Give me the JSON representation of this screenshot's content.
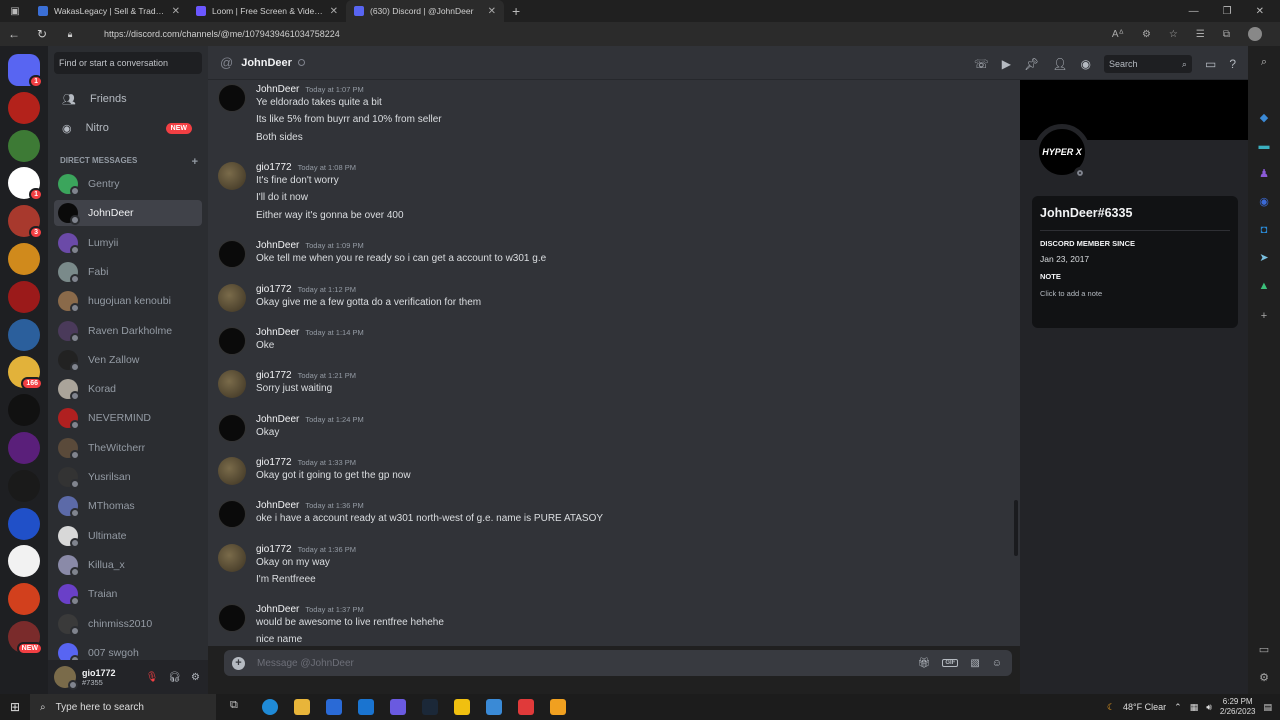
{
  "browser": {
    "tabs": [
      {
        "title": "WakasLegacy | Sell & Trade Gam",
        "color": "#3b6fd6"
      },
      {
        "title": "Loom | Free Screen & Video Rec",
        "color": "#6b57ff"
      },
      {
        "title": "(630) Discord | @JohnDeer",
        "color": "#5865f2"
      }
    ],
    "url": "https://discord.com/channels/@me/1079439461034758224"
  },
  "guilds": [
    {
      "color": "#5865f2",
      "badge": "1"
    },
    {
      "color": "#b3221b",
      "badge": ""
    },
    {
      "color": "#3d7a35",
      "badge": ""
    },
    {
      "color": "#ffffff",
      "badge": "1"
    },
    {
      "color": "#a8392d",
      "badge": "3"
    },
    {
      "color": "#d08a1c",
      "badge": ""
    },
    {
      "color": "#9b1a1a",
      "badge": ""
    },
    {
      "color": "#2b5f9c",
      "badge": ""
    },
    {
      "color": "#e2b23a",
      "badge": "166"
    },
    {
      "color": "#111111",
      "badge": ""
    },
    {
      "color": "#5a1f7a",
      "badge": ""
    },
    {
      "color": "#1a1a1a",
      "badge": ""
    },
    {
      "color": "#2050c8",
      "badge": ""
    },
    {
      "color": "#f2f2f2",
      "badge": ""
    },
    {
      "color": "#d2401d",
      "badge": ""
    },
    {
      "color": "#7a2b2b",
      "badge": "NEW"
    }
  ],
  "sidebar": {
    "search_placeholder": "Find or start a conversation",
    "friends": "Friends",
    "nitro": "Nitro",
    "nitro_badge": "NEW",
    "dm_header": "DIRECT MESSAGES",
    "dms": [
      {
        "name": "Gentry",
        "color": "#3ba55c"
      },
      {
        "name": "JohnDeer",
        "color": "#0a0a0a"
      },
      {
        "name": "Lumyii",
        "color": "#6b4aa8"
      },
      {
        "name": "Fabi",
        "color": "#7a8a8a"
      },
      {
        "name": "hugojuan kenoubi",
        "color": "#8a6a4a"
      },
      {
        "name": "Raven Darkholme",
        "color": "#4a3a5a"
      },
      {
        "name": "Ven Zallow",
        "color": "#222222"
      },
      {
        "name": "Korad",
        "color": "#aaa49a"
      },
      {
        "name": "NEVERMIND",
        "color": "#b02020"
      },
      {
        "name": "TheWitcherr",
        "color": "#5a4a3a"
      },
      {
        "name": "Yusrilsan",
        "color": "#333333"
      },
      {
        "name": "MThomas",
        "color": "#5c6aa8"
      },
      {
        "name": "Ultimate",
        "color": "#d8d8d8"
      },
      {
        "name": "Killua_x",
        "color": "#8a8aa8"
      },
      {
        "name": "Traian",
        "color": "#6a40c8"
      },
      {
        "name": "chinmiss2010",
        "color": "#3a3a3a"
      },
      {
        "name": "007 swgoh",
        "color": "#5865f2"
      }
    ],
    "user": {
      "name": "gio1772",
      "tag": "#7355"
    }
  },
  "chat": {
    "channel_name": "JohnDeer",
    "search_placeholder": "Search",
    "composer_placeholder": "Message @JohnDeer",
    "messages": [
      {
        "author": "JohnDeer",
        "time": "Today at 1:07 PM",
        "av": "jd",
        "lines": [
          "Ye eldorado takes quite a bit",
          "Its like 5% from buyrr and 10% from seller",
          "Both sides"
        ]
      },
      {
        "author": "gio1772",
        "time": "Today at 1:08 PM",
        "av": "gio",
        "lines": [
          "It's fine don't worry",
          "I'll do it now",
          "Either way it's gonna be over 400"
        ]
      },
      {
        "author": "JohnDeer",
        "time": "Today at 1:09 PM",
        "av": "jd",
        "lines": [
          "Oke tell me when you re ready so i can get a account to w301 g.e"
        ]
      },
      {
        "author": "gio1772",
        "time": "Today at 1:12 PM",
        "av": "gio",
        "lines": [
          "Okay give me a few gotta do a verification for them"
        ]
      },
      {
        "author": "JohnDeer",
        "time": "Today at 1:14 PM",
        "av": "jd",
        "lines": [
          "Oke"
        ]
      },
      {
        "author": "gio1772",
        "time": "Today at 1:21 PM",
        "av": "gio",
        "lines": [
          "Sorry just waiting"
        ]
      },
      {
        "author": "JohnDeer",
        "time": "Today at 1:24 PM",
        "av": "jd",
        "lines": [
          "Okay"
        ]
      },
      {
        "author": "gio1772",
        "time": "Today at 1:33 PM",
        "av": "gio",
        "lines": [
          "Okay got it going to get the gp now"
        ]
      },
      {
        "author": "JohnDeer",
        "time": "Today at 1:36 PM",
        "av": "jd",
        "lines": [
          "oke i have a account ready at w301 north-west of g.e. name is PURE ATASOY"
        ]
      },
      {
        "author": "gio1772",
        "time": "Today at 1:36 PM",
        "av": "gio",
        "lines": [
          "Okay on my way",
          "I'm Rentfreee"
        ]
      },
      {
        "author": "JohnDeer",
        "time": "Today at 1:37 PM",
        "av": "jd",
        "lines": [
          "would be awesome to live rentfree hehehe",
          "nice name"
        ]
      }
    ]
  },
  "profile": {
    "avatar_text": "HYPER X",
    "username": "JohnDeer#6335",
    "member_since_label": "DISCORD MEMBER SINCE",
    "member_since": "Jan 23, 2017",
    "note_label": "NOTE",
    "note_placeholder": "Click to add a note"
  },
  "taskbar": {
    "search": "Type here to search",
    "weather": "48°F  Clear",
    "time": "6:29 PM",
    "date": "2/26/2023"
  }
}
